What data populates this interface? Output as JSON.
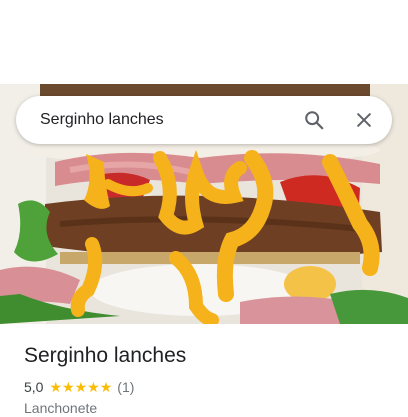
{
  "search": {
    "query": "Serginho lanches"
  },
  "place": {
    "name": "Serginho lanches",
    "rating": "5,0",
    "stars": 5,
    "review_count": "(1)",
    "category": "Lanchonete"
  },
  "hero_photo": {
    "subject": "burger-with-cheese-sauce"
  },
  "icons": {
    "search": "search-icon",
    "close": "close-icon",
    "star": "star-icon"
  },
  "colors": {
    "star": "#fbbc04",
    "text_primary": "#202124",
    "text_secondary": "#70757a"
  }
}
